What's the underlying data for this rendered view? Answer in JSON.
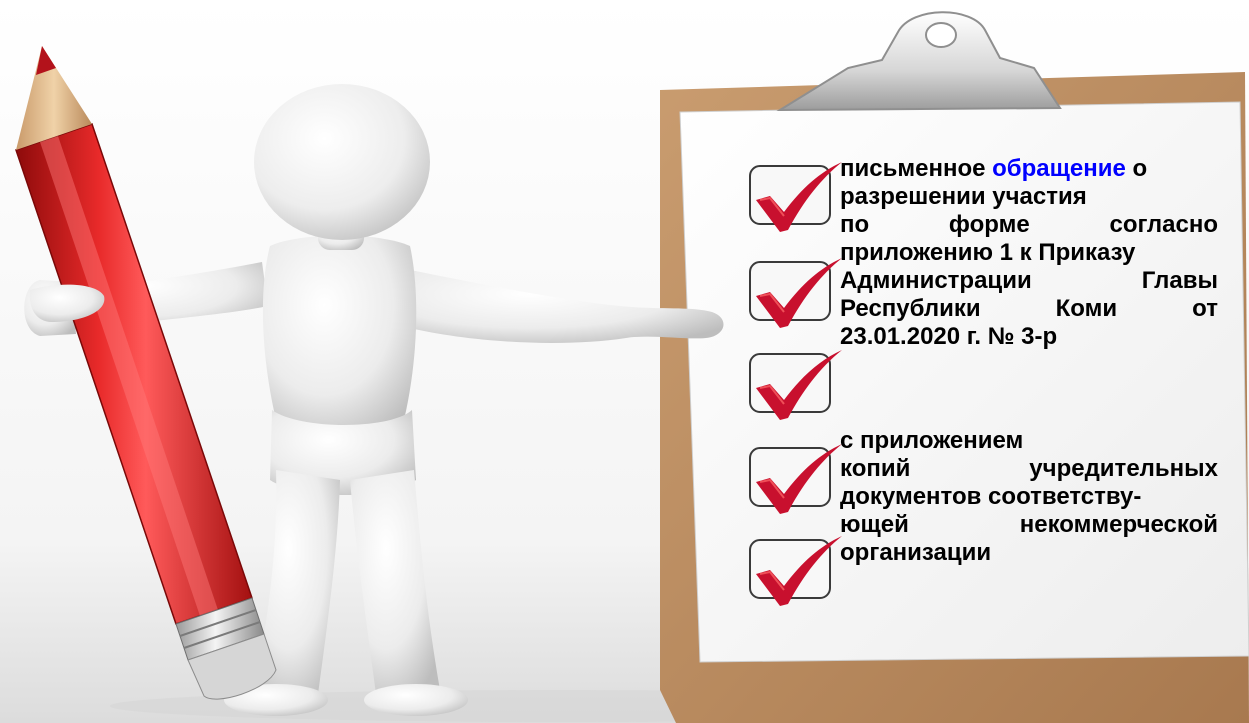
{
  "checklist": {
    "block1": {
      "line1_part1": "письменное",
      "line1_highlight": "обращение",
      "line1_part2": "о",
      "line2": "разрешении участия",
      "line3_words": [
        "по",
        "форме",
        "согласно"
      ],
      "line4": "приложению 1 к Приказу",
      "line5_words": [
        "Администрации",
        "Главы"
      ],
      "line6_words": [
        "Республики",
        "Коми",
        "от"
      ],
      "line7": "23.01.2020 г. № 3-р"
    },
    "block2": {
      "line1": "с приложением",
      "line2_words": [
        "копий",
        "учредительных"
      ],
      "line3": "документов соответству-",
      "line4_words": [
        "ющей",
        "некоммерческой"
      ],
      "line5": "организации"
    }
  },
  "colors": {
    "highlight": "#0000ff",
    "text": "#000000",
    "checkmark": "#c8102e",
    "pencil": "#d81e1e",
    "clipboard": "#b8875a"
  },
  "icons": [
    "pencil-icon",
    "figure-icon",
    "clipboard-icon",
    "checkbox-icon",
    "checkmark-icon"
  ]
}
